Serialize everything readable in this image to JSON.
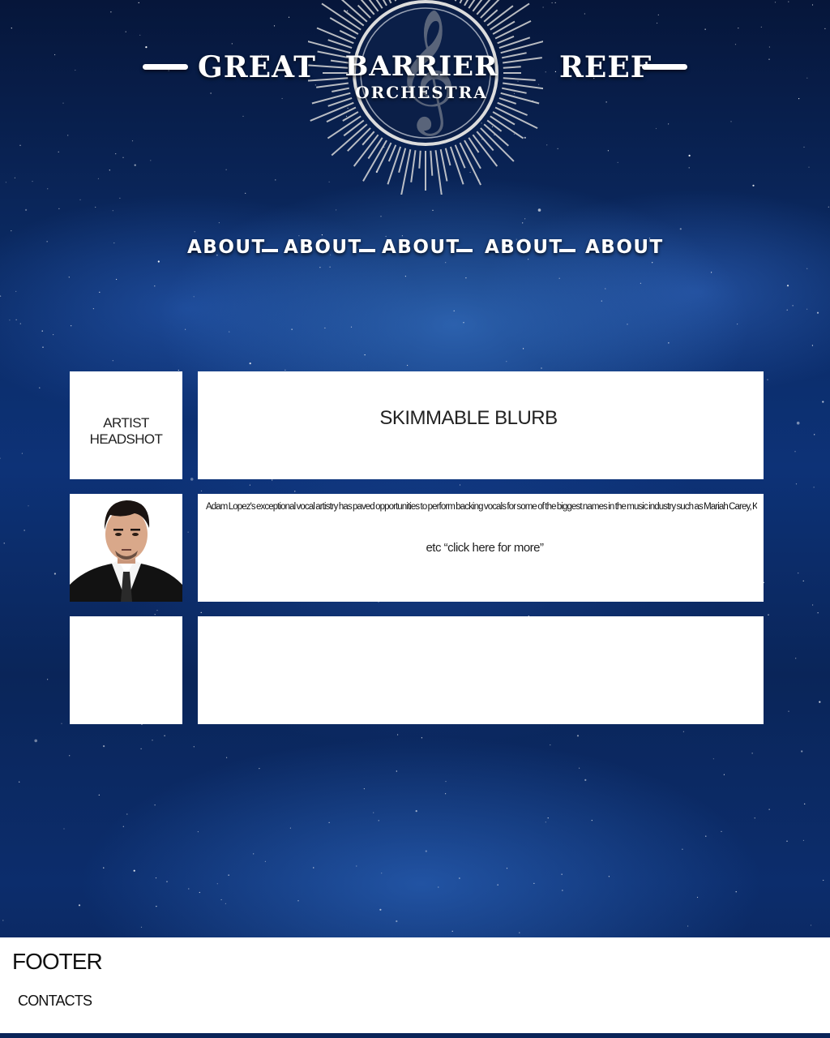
{
  "header": {
    "word_left": "GREAT",
    "word_center": "BARRIER",
    "word_sub": "ORCHESTRA",
    "word_right": "REEF"
  },
  "nav": {
    "items": [
      {
        "label": "ABOUT"
      },
      {
        "label": "ABOUT"
      },
      {
        "label": "ABOUT"
      },
      {
        "label": "ABOUT"
      },
      {
        "label": "ABOUT"
      }
    ]
  },
  "rows": [
    {
      "thumb_label": "ARTIST HEADSHOT",
      "panel_title": "SKIMMABLE BLURB"
    },
    {
      "thumb_image": "artist-photo",
      "panel_text": "Adam Lopez's exceptional vocal artistry has paved opportunities to perform backing vocals for some of the biggest names in the music industry such as Mariah Carey, Keith Urban and The Coors.",
      "panel_link": "etc “click here for more”"
    },
    {
      "thumb_label": "",
      "panel_title": ""
    }
  ],
  "footer": {
    "title": "FOOTER",
    "contacts_label": "CONTACTS"
  },
  "colors": {
    "background_top": "#06163a",
    "background_mid": "#0d3277",
    "panel": "#ffffff",
    "text_light": "#ffffff",
    "text_dark": "#222222"
  }
}
